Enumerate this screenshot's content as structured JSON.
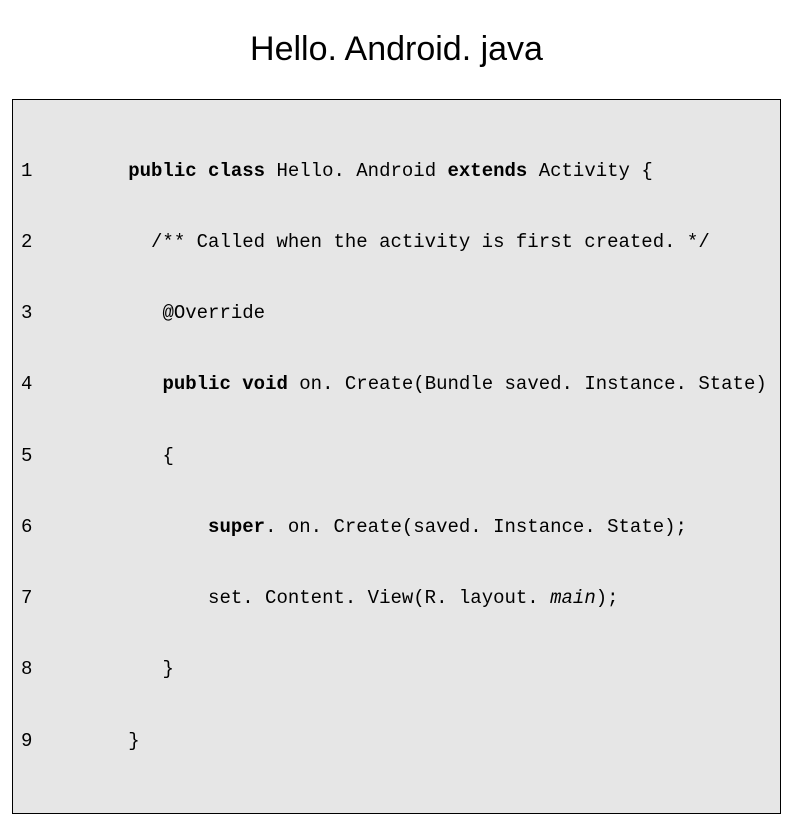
{
  "title": "Hello. Android. java",
  "gutter": [
    "1",
    "2",
    "3",
    "4",
    "5",
    "6",
    "7",
    "8",
    "9"
  ],
  "code": {
    "l1": {
      "kw1": "public",
      "kw2": "class",
      "t1": " Hello. Android ",
      "kw3": "extends",
      "t2": " Activity {"
    },
    "l2": "  /** Called when the activity is first created. */",
    "l3": "   @Override",
    "l4": {
      "pad": "   ",
      "kw1": "public",
      "kw2": "void",
      "t1": " on. Create(Bundle saved. Instance. State)"
    },
    "l5": "   {",
    "l6": {
      "pad": "       ",
      "kw1": "super",
      "t1": ". on. Create(saved. Instance. State);"
    },
    "l7": {
      "pad": "       ",
      "t1": "set. Content. View(R. layout. ",
      "it": "main",
      "t2": ");"
    },
    "l8": "   }",
    "l9": "}"
  }
}
